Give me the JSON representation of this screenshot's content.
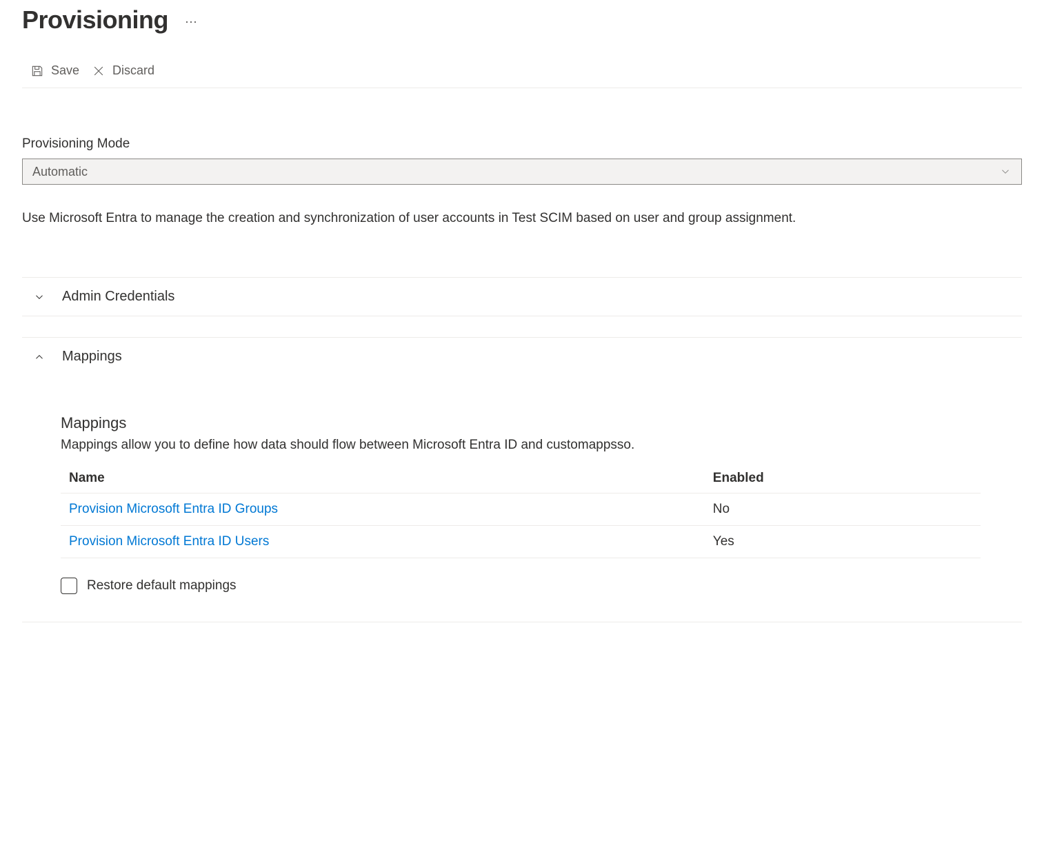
{
  "header": {
    "title": "Provisioning"
  },
  "toolbar": {
    "save_label": "Save",
    "discard_label": "Discard"
  },
  "form": {
    "mode_label": "Provisioning Mode",
    "mode_value": "Automatic",
    "description": "Use Microsoft Entra to manage the creation and synchronization of user accounts in Test SCIM based on user and group assignment."
  },
  "sections": {
    "admin_credentials": {
      "title": "Admin Credentials"
    },
    "mappings": {
      "title": "Mappings",
      "subtitle": "Mappings",
      "description": "Mappings allow you to define how data should flow between Microsoft Entra ID and customappsso.",
      "columns": {
        "name": "Name",
        "enabled": "Enabled"
      },
      "rows": [
        {
          "name": "Provision Microsoft Entra ID Groups",
          "enabled": "No"
        },
        {
          "name": "Provision Microsoft Entra ID Users",
          "enabled": "Yes"
        }
      ],
      "restore_label": "Restore default mappings"
    }
  }
}
